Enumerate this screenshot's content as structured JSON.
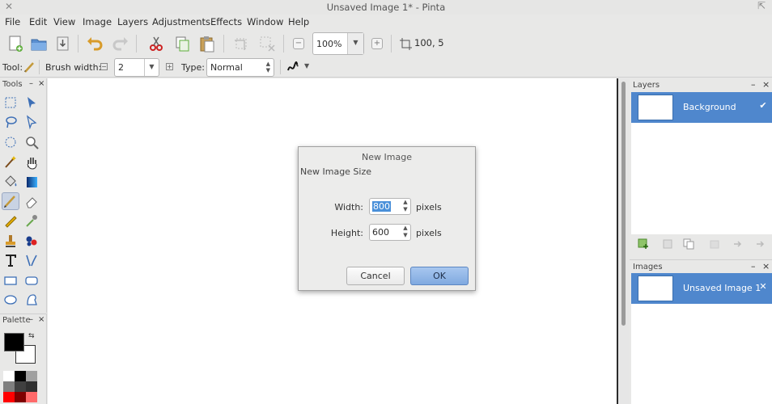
{
  "window": {
    "title": "Unsaved Image 1* - Pinta"
  },
  "menu": [
    "File",
    "Edit",
    "View",
    "Image",
    "Layers",
    "Adjustments",
    "Effects",
    "Window",
    "Help"
  ],
  "toolbar": {
    "zoom": "100%",
    "coords": "100, 5"
  },
  "tool_options": {
    "tool_label": "Tool:",
    "brush_width_label": "Brush width:",
    "brush_width": "2",
    "type_label": "Type:",
    "type_value": "Normal"
  },
  "panels": {
    "tools_title": "Tools",
    "palette_title": "Palette",
    "layers_title": "Layers",
    "images_title": "Images"
  },
  "layers": [
    {
      "name": "Background",
      "visible": true
    }
  ],
  "images": [
    {
      "name": "Unsaved Image 1"
    }
  ],
  "dialog": {
    "title": "New Image",
    "subtitle": "New Image Size",
    "width_label": "Width:",
    "width_value": "800",
    "height_label": "Height:",
    "height_value": "600",
    "unit": "pixels",
    "cancel_label": "Cancel",
    "ok_label": "OK"
  },
  "colors": {
    "primary": "#000000",
    "secondary": "#ffffff",
    "selection": "#4f87cd",
    "palette": [
      "#ffffff",
      "#000000",
      "#a0a0a0",
      "#7f7f7f",
      "#404040",
      "#303030",
      "#ff0000",
      "#7f0000",
      "#ff6a6a",
      "#d40000"
    ]
  }
}
